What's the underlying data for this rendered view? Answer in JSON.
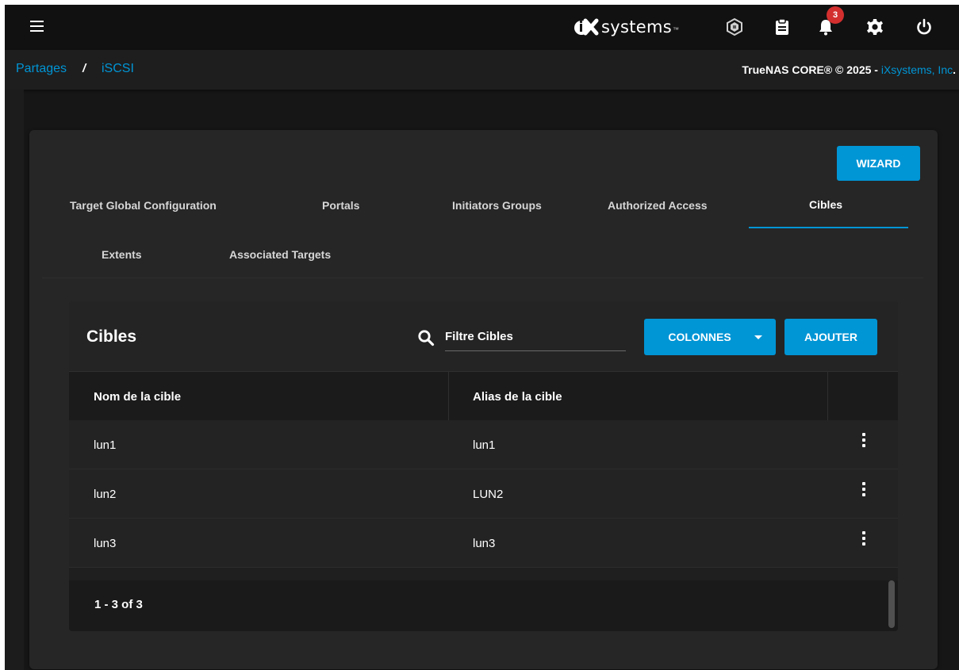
{
  "topbar": {
    "brand_text": "systems",
    "brand_tm": "™",
    "notification_count": "3",
    "icons": [
      "menu-icon",
      "truecommand-icon",
      "clipboard-icon",
      "bell-icon",
      "gear-icon",
      "power-icon"
    ]
  },
  "breadcrumb": {
    "parent": "Partages",
    "separator": "/",
    "current": "iSCSI"
  },
  "copyright": {
    "text": "TrueNAS CORE® © 2025 - ",
    "link": "iXsystems, Inc",
    "suffix": "."
  },
  "actions": {
    "wizard_label": "WIZARD"
  },
  "tabs": [
    {
      "label": "Target Global Configuration"
    },
    {
      "label": "Portals"
    },
    {
      "label": "Initiators Groups"
    },
    {
      "label": "Authorized Access"
    },
    {
      "label": "Cibles",
      "active": true
    },
    {
      "label": "Extents"
    },
    {
      "label": "Associated Targets"
    }
  ],
  "table": {
    "title": "Cibles",
    "search_placeholder": "Filtre Cibles",
    "columns_button": "COLONNES",
    "add_button": "AJOUTER",
    "columns": [
      "Nom de la cible",
      "Alias de la cible"
    ],
    "rows": [
      {
        "name": "lun1",
        "alias": "lun1"
      },
      {
        "name": "lun2",
        "alias": "LUN2"
      },
      {
        "name": "lun3",
        "alias": "lun3"
      }
    ],
    "paginator": "1 - 3 of 3"
  },
  "colors": {
    "accent": "#0095d5",
    "badge": "#d32f2f",
    "background": "#161616",
    "card": "#262626"
  }
}
